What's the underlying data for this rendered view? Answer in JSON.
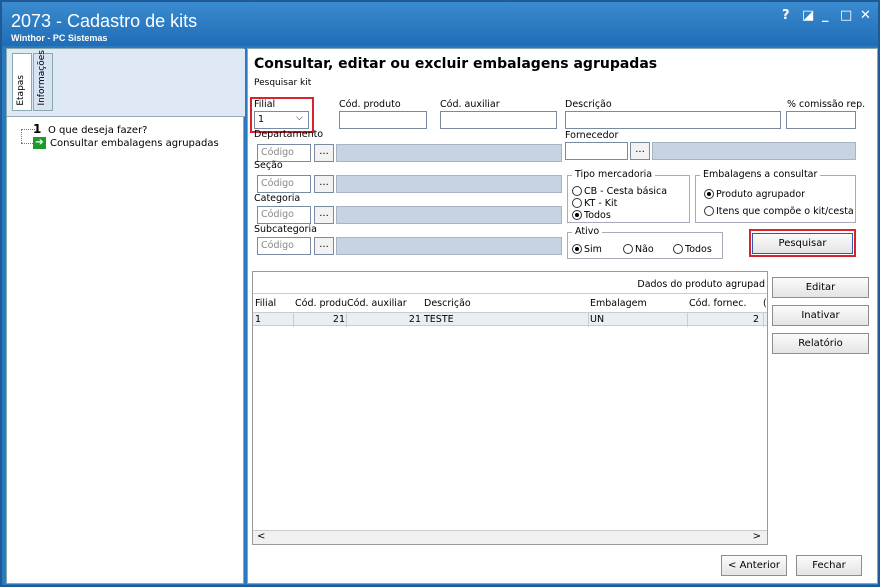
{
  "window": {
    "title": "2073 - Cadastro de kits",
    "subtitle": "Winthor - PC Sistemas",
    "controls": {
      "help": "?",
      "restore": "◪",
      "minimize": "_",
      "maximize": "□",
      "close": "✕"
    }
  },
  "sidebar": {
    "tabs": [
      "Etapas",
      "Informações"
    ],
    "step_number": "1",
    "step_label": "O que deseja fazer?",
    "substep_label": "Consultar embalagens agrupadas"
  },
  "main": {
    "title": "Consultar, editar ou excluir embalagens agrupadas",
    "subtitle": "Pesquisar kit",
    "filial": {
      "label": "Filial",
      "value": "1"
    },
    "cod_produto": {
      "label": "Cód. produto",
      "value": ""
    },
    "cod_auxiliar": {
      "label": "Cód. auxiliar",
      "value": ""
    },
    "descricao": {
      "label": "Descrição",
      "value": ""
    },
    "comissao": {
      "label": "% comissão rep.",
      "value": ""
    },
    "departamento": {
      "label": "Departamento",
      "placeholder": "Código"
    },
    "fornecedor": {
      "label": "Fornecedor"
    },
    "secao": {
      "label": "Seção",
      "placeholder": "Código"
    },
    "categoria": {
      "label": "Categoria",
      "placeholder": "Código"
    },
    "subcategoria": {
      "label": "Subcategoria",
      "placeholder": "Código"
    },
    "dots": "...",
    "tipo_mercadoria": {
      "title": "Tipo mercadoria",
      "options": [
        "CB - Cesta básica",
        "KT - Kit",
        "Todos"
      ],
      "selected": "Todos"
    },
    "embalagens": {
      "title": "Embalagens a consultar",
      "options": [
        "Produto agrupador",
        "Itens que compõe o kit/cesta"
      ],
      "selected": "Produto agrupador"
    },
    "ativo": {
      "title": "Ativo",
      "options": [
        "Sim",
        "Não",
        "Todos"
      ],
      "selected": "Sim"
    },
    "pesquisar_label": "Pesquisar",
    "grid": {
      "band": "Dados do produto agrupad",
      "columns": [
        "Filial",
        "Cód. produ",
        "Cód. auxiliar",
        "Descrição",
        "Embalagem",
        "Cód. fornec.",
        "("
      ],
      "rows": [
        {
          "filial": "1",
          "cod_produto": "21",
          "cod_auxiliar": "21",
          "descricao": "TESTE",
          "embalagem": "UN",
          "cod_fornec": "2"
        }
      ]
    },
    "actions": {
      "editar": "Editar",
      "inativar": "Inativar",
      "relatorio": "Relatório"
    },
    "footer": {
      "anterior": "< Anterior",
      "fechar": "Fechar"
    }
  }
}
